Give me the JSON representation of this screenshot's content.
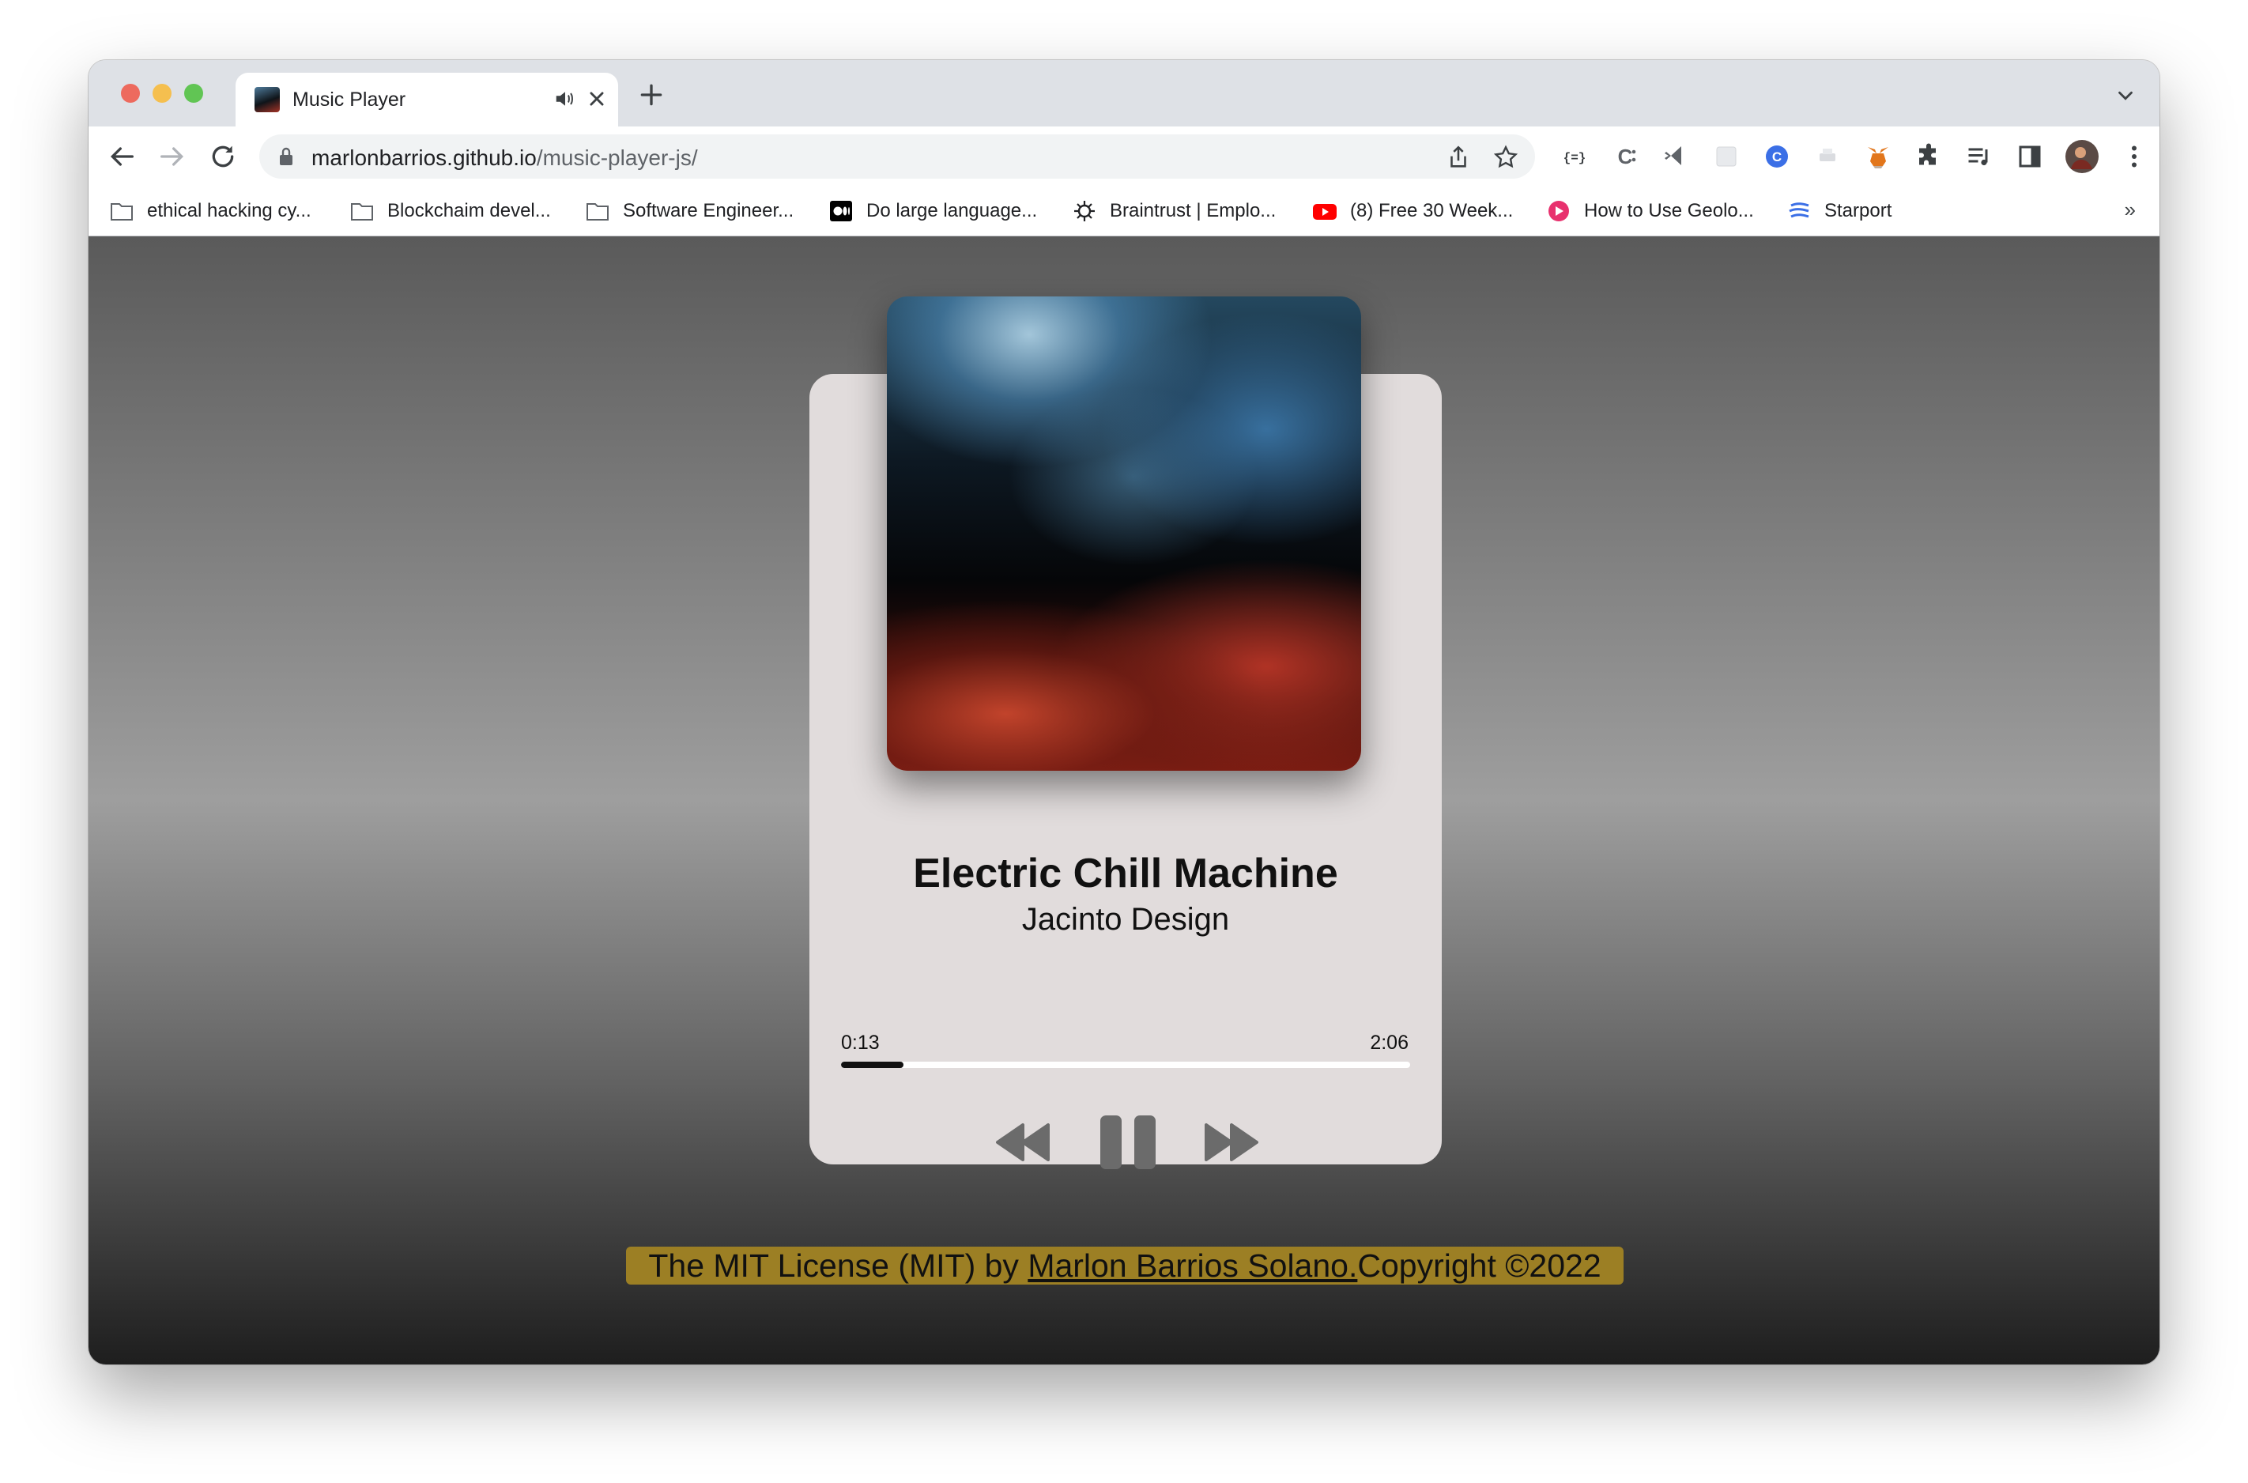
{
  "tab": {
    "title": "Music Player"
  },
  "address_bar": {
    "host": "marlonbarrios.github.io",
    "path": "/music-player-js/"
  },
  "bookmarks": [
    {
      "label": "ethical hacking cy...",
      "icon": "folder-icon"
    },
    {
      "label": "Blockchaim devel...",
      "icon": "folder-icon"
    },
    {
      "label": "Software Engineer...",
      "icon": "folder-icon"
    },
    {
      "label": "Do large language...",
      "icon": "medium-icon"
    },
    {
      "label": "Braintrust | Emplo...",
      "icon": "braintrust-icon"
    },
    {
      "label": "(8) Free 30 Week...",
      "icon": "youtube-icon"
    },
    {
      "label": "How to Use Geolo...",
      "icon": "pinned-site-icon"
    },
    {
      "label": "Starport",
      "icon": "starport-icon"
    }
  ],
  "bookmarks_more": "»",
  "player": {
    "song_title": "Electric Chill Machine",
    "artist": "Jacinto Design",
    "current_time": "0:13",
    "duration": "2:06",
    "progress_fraction": 0.11,
    "state": "playing"
  },
  "footer": {
    "prefix": "The MIT License (MIT) by ",
    "author_link": "Marlon Barrios Solano.",
    "suffix": "Copyright ©2022",
    "background": "#9c7f24"
  },
  "colors": {
    "card": "#e1dcdc",
    "control_icons": "#6b6b6b",
    "progress_fill": "#111111",
    "progress_track": "#ffffff"
  }
}
